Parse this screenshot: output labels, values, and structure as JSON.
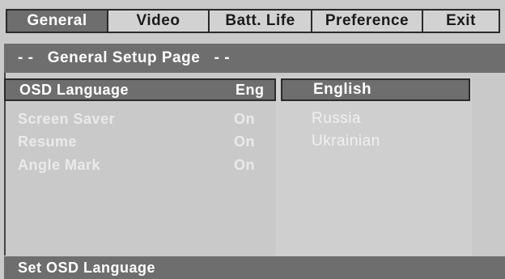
{
  "tabs": [
    {
      "label": "General",
      "active": true
    },
    {
      "label": "Video",
      "active": false
    },
    {
      "label": "Batt. Life",
      "active": false
    },
    {
      "label": "Preference",
      "active": false
    },
    {
      "label": "Exit",
      "active": false
    }
  ],
  "page_title": "- -   General Setup Page   - -",
  "settings": [
    {
      "label": "OSD Language",
      "value": "Eng",
      "selected": true
    },
    {
      "label": "Screen Saver",
      "value": "On",
      "selected": false
    },
    {
      "label": "Resume",
      "value": "On",
      "selected": false
    },
    {
      "label": "Angle Mark",
      "value": "On",
      "selected": false
    }
  ],
  "options": [
    {
      "label": "English",
      "selected": true
    },
    {
      "label": "Russia",
      "selected": false
    },
    {
      "label": "Ukrainian",
      "selected": false
    }
  ],
  "status": "Set OSD Language",
  "colors": {
    "background": "#c9c9c9",
    "highlight": "#6e6e6e",
    "text_light": "#ffffff",
    "text_dark": "#1a1a1a"
  }
}
